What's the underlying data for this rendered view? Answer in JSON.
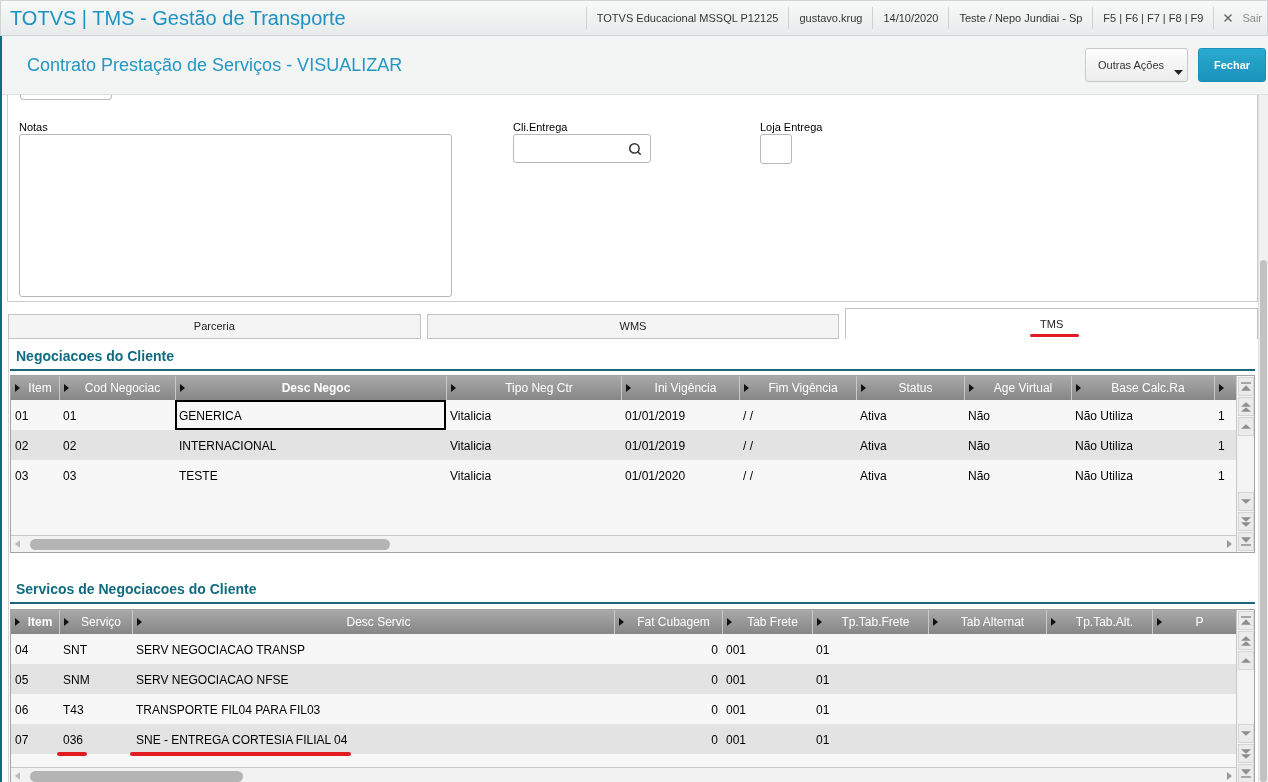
{
  "top_bar": {
    "title": "TOTVS | TMS - Gestão de Transporte",
    "info": [
      "TOTVS Educacional MSSQL P12125",
      "gustavo.krug",
      "14/10/2020",
      "Teste / Nepo Jundiai - Sp",
      "F5 | F6 | F7 | F8 | F9"
    ],
    "exit": "Sair"
  },
  "header": {
    "title": "Contrato Prestação de Serviços - VISUALIZAR",
    "buttons": [
      {
        "label": "Outras Ações",
        "kind": "menu"
      },
      {
        "label": "Fechar",
        "kind": "primary"
      }
    ]
  },
  "form": {
    "fields": [
      {
        "label": "Notas",
        "kind": "textarea"
      },
      {
        "label": "Cli.Entrega",
        "kind": "lookup"
      },
      {
        "label": "Loja Entrega",
        "kind": "small"
      }
    ]
  },
  "tabs": [
    {
      "label": "Parceria",
      "selected": false,
      "marked": false
    },
    {
      "label": "WMS",
      "selected": false,
      "marked": false
    },
    {
      "label": "TMS",
      "selected": true,
      "marked": true
    }
  ],
  "negotiations": {
    "title": "Negociacoes do Cliente",
    "columns": [
      {
        "label": "Item",
        "current": false
      },
      {
        "label": "Cod Negociac",
        "current": false
      },
      {
        "label": "Desc Negoc",
        "current": true
      },
      {
        "label": "Tipo Neg Ctr",
        "current": false
      },
      {
        "label": "Ini Vigência",
        "current": false
      },
      {
        "label": "Fim Vigência",
        "current": false
      },
      {
        "label": "Status",
        "current": false
      },
      {
        "label": "Age Virtual",
        "current": false
      },
      {
        "label": "Base Calc.Ra",
        "current": false
      },
      {}
    ],
    "rows": [
      {
        "cells": [
          "01",
          "01",
          "GENERICA",
          "Vitalicia",
          "01/01/2019",
          "/ /",
          "Ativa",
          "Não",
          "Não Utiliza",
          "1"
        ],
        "focused": true
      },
      {
        "cells": [
          "02",
          "02",
          "INTERNACIONAL",
          "Vitalicia",
          "01/01/2019",
          "/ /",
          "Ativa",
          "Não",
          "Não Utiliza",
          "1"
        ],
        "focused": false
      },
      {
        "cells": [
          "03",
          "03",
          "TESTE",
          "Vitalicia",
          "01/01/2020",
          "/ /",
          "Ativa",
          "Não",
          "Não Utiliza",
          "1"
        ],
        "focused": false
      }
    ]
  },
  "services": {
    "title": "Servicos de Negociacoes do Cliente",
    "columns": [
      {
        "label": "Item",
        "current": true,
        "kind": "text"
      },
      {
        "label": "Serviço",
        "current": false,
        "kind": "text"
      },
      {
        "label": "Desc Servic",
        "current": false,
        "kind": "text"
      },
      {
        "label": "Fat Cubagem",
        "current": false,
        "kind": "number"
      },
      {
        "label": "Tab Frete",
        "current": false,
        "kind": "text"
      },
      {
        "label": "Tp.Tab.Frete",
        "current": false,
        "kind": "text"
      },
      {
        "label": "Tab Alternat",
        "current": false,
        "kind": "text"
      },
      {
        "label": "Tp.Tab.Alt.",
        "current": false,
        "kind": "text"
      },
      {
        "label": "P",
        "current": false,
        "kind": "text"
      }
    ],
    "rows": [
      {
        "cells": [
          {
            "text": "04",
            "marked": false
          },
          {
            "text": "SNT",
            "marked": false
          },
          {
            "text": "SERV NEGOCIACAO TRANSP",
            "marked": false
          },
          {
            "text": "0",
            "marked": false
          },
          {
            "text": "001",
            "marked": false
          },
          {
            "text": "01",
            "marked": false
          }
        ]
      },
      {
        "cells": [
          {
            "text": "05",
            "marked": false
          },
          {
            "text": "SNM",
            "marked": false
          },
          {
            "text": "SERV NEGOCIACAO NFSE",
            "marked": false
          },
          {
            "text": "0",
            "marked": false
          },
          {
            "text": "001",
            "marked": false
          },
          {
            "text": "01",
            "marked": false
          }
        ]
      },
      {
        "cells": [
          {
            "text": "06",
            "marked": false
          },
          {
            "text": "T43",
            "marked": false
          },
          {
            "text": "TRANSPORTE FIL04 PARA FIL03",
            "marked": false
          },
          {
            "text": "0",
            "marked": false
          },
          {
            "text": "001",
            "marked": false
          },
          {
            "text": "01",
            "marked": false
          }
        ]
      },
      {
        "cells": [
          {
            "text": "07",
            "marked": false
          },
          {
            "text": "036",
            "marked": true
          },
          {
            "text": "SNE - ENTREGA CORTESIA FILIAL 04",
            "marked": true
          },
          {
            "text": "0",
            "marked": false
          },
          {
            "text": "001",
            "marked": false
          },
          {
            "text": "01",
            "marked": false
          }
        ]
      }
    ]
  }
}
